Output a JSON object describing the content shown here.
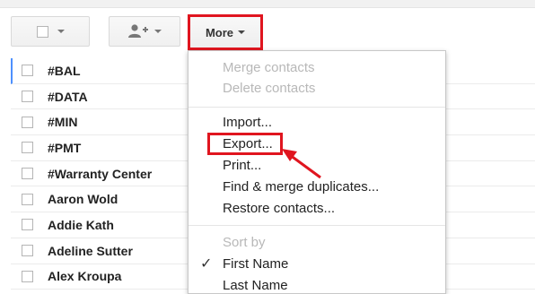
{
  "toolbar": {
    "more_label": "More"
  },
  "contacts": [
    "#BAL",
    "#DATA",
    "#MIN",
    "#PMT",
    "#Warranty Center",
    "Aaron Wold",
    "Addie Kath",
    "Adeline Sutter",
    "Alex Kroupa"
  ],
  "menu": {
    "merge": "Merge contacts",
    "delete": "Delete contacts",
    "import": "Import...",
    "export": "Export...",
    "print": "Print...",
    "find_merge": "Find & merge duplicates...",
    "restore": "Restore contacts...",
    "sort_by": "Sort by",
    "first_name": "First Name",
    "last_name": "Last Name",
    "check_mark": "✓"
  },
  "colors": {
    "highlight_red": "#e0151f",
    "selected_row_accent": "#4d90fe"
  },
  "icons": {
    "select": "checkbox-icon",
    "add_contact": "person-add-icon",
    "dropdown": "caret-down-icon",
    "annotation": "red-arrow-icon"
  }
}
